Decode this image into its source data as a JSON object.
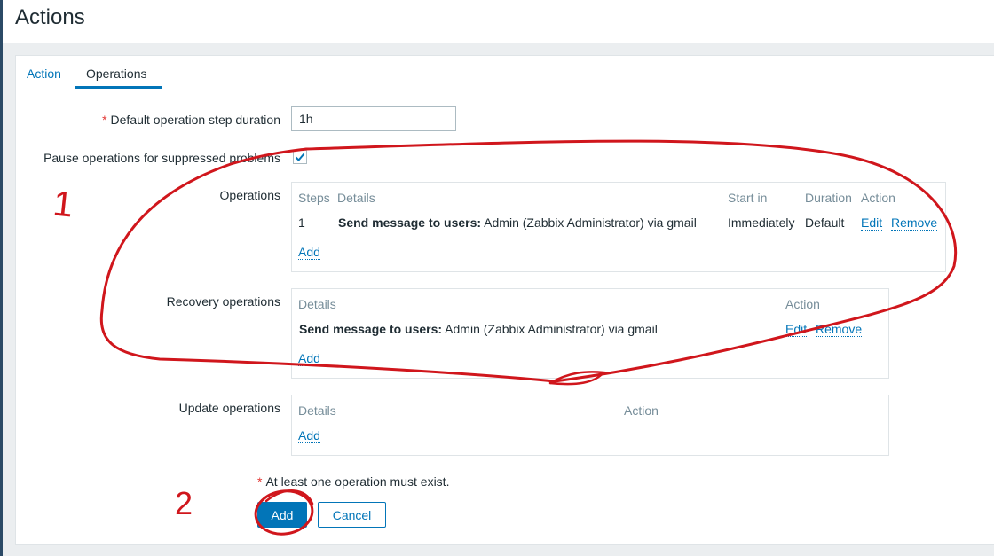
{
  "page": {
    "title": "Actions"
  },
  "tabs": [
    {
      "label": "Action"
    },
    {
      "label": "Operations"
    }
  ],
  "form": {
    "step_duration": {
      "label": "Default operation step duration",
      "value": "1h"
    },
    "pause_suppressed": {
      "label": "Pause operations for suppressed problems",
      "checked": true
    },
    "operations": {
      "label": "Operations",
      "headers": {
        "steps": "Steps",
        "details": "Details",
        "start_in": "Start in",
        "duration": "Duration",
        "action": "Action"
      },
      "rows": [
        {
          "steps": "1",
          "details_bold": "Send message to users:",
          "details_rest": " Admin (Zabbix Administrator) via gmail",
          "start_in": "Immediately",
          "duration": "Default",
          "edit": "Edit",
          "remove": "Remove"
        }
      ],
      "add": "Add"
    },
    "recovery_operations": {
      "label": "Recovery operations",
      "headers": {
        "details": "Details",
        "action": "Action"
      },
      "rows": [
        {
          "details_bold": "Send message to users:",
          "details_rest": " Admin (Zabbix Administrator) via gmail",
          "edit": "Edit",
          "remove": "Remove"
        }
      ],
      "add": "Add"
    },
    "update_operations": {
      "label": "Update operations",
      "headers": {
        "details": "Details",
        "action": "Action"
      },
      "add": "Add"
    },
    "note": "At least one operation must exist.",
    "buttons": {
      "add": "Add",
      "cancel": "Cancel"
    }
  },
  "annotations": {
    "mark1": "1",
    "mark2": "2"
  },
  "colors": {
    "link": "#0275b8",
    "annotation": "#d0161c",
    "required": "#e33734"
  }
}
